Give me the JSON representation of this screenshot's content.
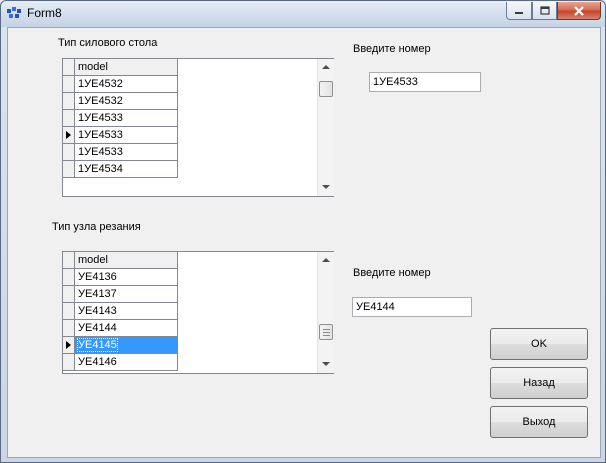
{
  "window": {
    "title": "Form8"
  },
  "section1": {
    "label": "Тип силового  стола",
    "grid": {
      "header": "model",
      "rows": [
        {
          "value": "1УЕ4532",
          "current": false,
          "selected": false
        },
        {
          "value": "1УЕ4532",
          "current": false,
          "selected": false
        },
        {
          "value": "1УЕ4533",
          "current": false,
          "selected": false
        },
        {
          "value": "1УЕ4533",
          "current": true,
          "selected": false
        },
        {
          "value": "1УЕ4533",
          "current": false,
          "selected": false
        },
        {
          "value": "1УЕ4534",
          "current": false,
          "selected": false
        }
      ]
    },
    "number_label": "Введите номер",
    "number_value": "1УЕ4533"
  },
  "section2": {
    "label": "Тип узла резания",
    "grid": {
      "header": "model",
      "rows": [
        {
          "value": "УЕ4136",
          "current": false,
          "selected": false
        },
        {
          "value": "УЕ4137",
          "current": false,
          "selected": false
        },
        {
          "value": "УЕ4143",
          "current": false,
          "selected": false
        },
        {
          "value": "УЕ4144",
          "current": false,
          "selected": false
        },
        {
          "value": "УЕ4145",
          "current": true,
          "selected": true
        },
        {
          "value": "УЕ4146",
          "current": false,
          "selected": false
        }
      ]
    },
    "number_label": "Введите номер",
    "number_value": "УЕ4144"
  },
  "buttons": {
    "ok": "OK",
    "back": "Назад",
    "exit": "Выход"
  },
  "colors": {
    "selection": "#3399ff",
    "close_button": "#c3462c"
  },
  "icons": {
    "app": "app-form-icon",
    "minimize": "minimize-icon",
    "maximize": "maximize-icon",
    "close": "close-icon"
  }
}
